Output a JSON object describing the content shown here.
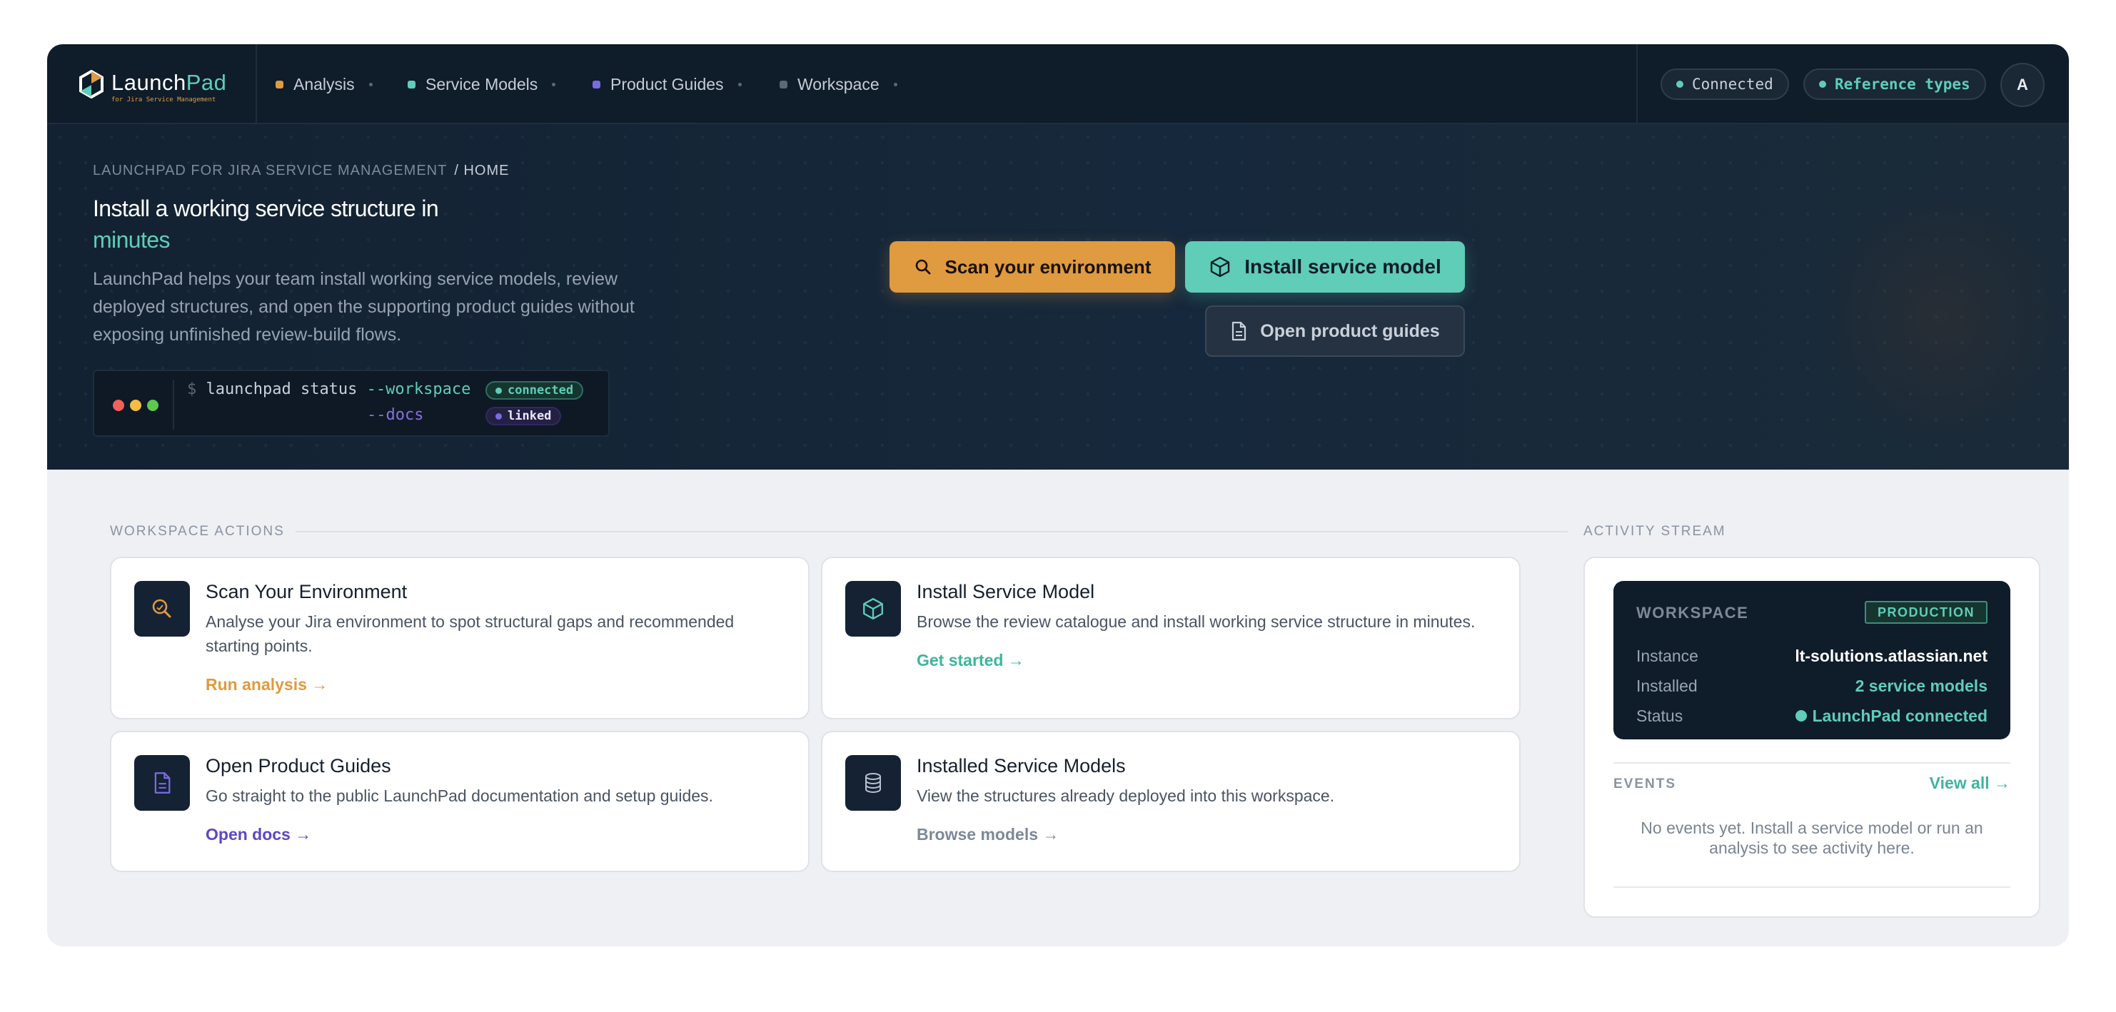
{
  "brand": {
    "name_main": "Launch",
    "name_accent": "Pad",
    "subtitle": "for Jira Service Management"
  },
  "nav": {
    "items": [
      {
        "label": "Analysis",
        "color": "#e09a3f"
      },
      {
        "label": "Service Models",
        "color": "#5fcdb8"
      },
      {
        "label": "Product Guides",
        "color": "#7b6be0"
      },
      {
        "label": "Workspace",
        "color": "#5b6878"
      }
    ],
    "status_pill": "Connected",
    "types_pill": "Reference types",
    "avatar_initial": "A"
  },
  "hero": {
    "breadcrumb_root": "LAUNCHPAD FOR JIRA SERVICE MANAGEMENT",
    "breadcrumb_current": "/ HOME",
    "title_line1": "Install a working service structure in",
    "title_accent": "minutes",
    "description": "LaunchPad helps your team install working service models, review deployed structures, and open the supporting product guides without exposing unfinished review-build flows.",
    "terminal": {
      "prompt": "$",
      "command": "launchpad status",
      "flag1": "--workspace",
      "badge1": "connected",
      "flag2": "--docs",
      "badge2": "linked"
    },
    "cta_scan": "Scan your environment",
    "cta_install": "Install service model",
    "cta_guides": "Open product guides"
  },
  "workspace_actions": {
    "label": "WORKSPACE ACTIONS",
    "cards": [
      {
        "title": "Scan Your Environment",
        "desc": "Analyse your Jira environment to spot structural gaps and recommended starting points.",
        "link": "Run analysis →",
        "link_color": "#e09a3f",
        "icon": "search-icon"
      },
      {
        "title": "Install Service Model",
        "desc": "Browse the review catalogue and install working service structure in minutes.",
        "link": "Get started →",
        "link_color": "#3fb49e",
        "icon": "cube-icon"
      },
      {
        "title": "Open Product Guides",
        "desc": "Go straight to the public LaunchPad documentation and setup guides.",
        "link": "Open docs →",
        "link_color": "#5b48c4",
        "icon": "document-icon"
      },
      {
        "title": "Installed Service Models",
        "desc": "View the structures already deployed into this workspace.",
        "link": "Browse models →",
        "link_color": "#7d8998",
        "icon": "database-icon"
      }
    ]
  },
  "activity": {
    "label": "ACTIVITY STREAM",
    "workspace": {
      "label": "WORKSPACE",
      "badge": "PRODUCTION",
      "rows": [
        {
          "key": "Instance",
          "value": "lt-solutions.atlassian.net"
        },
        {
          "key": "Installed",
          "value": "2 service models"
        },
        {
          "key": "Status",
          "value": "LaunchPad connected"
        }
      ]
    },
    "events_label": "EVENTS",
    "view_all": "View all →",
    "empty_text": "No events yet. Install a service model or run an analysis to see activity here."
  },
  "colors": {
    "accent_teal": "#5fcdb8",
    "accent_orange": "#e09a3f",
    "accent_purple": "#7b6be0",
    "nav_bg": "#0f1c2a"
  }
}
